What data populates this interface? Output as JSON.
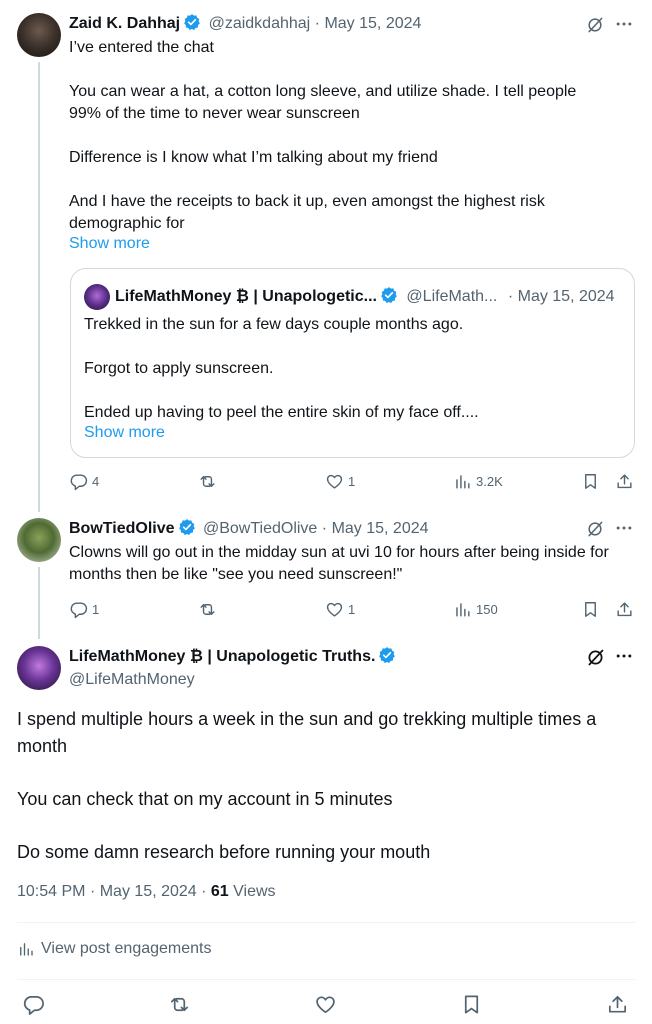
{
  "reply1": {
    "name": "Zaid K. Dahhaj",
    "handle": "@zaidkdahhaj",
    "sep": "·",
    "date": "May 15, 2024",
    "body": "I’ve entered the chat\n\nYou can wear a hat, a cotton long sleeve, and utilize shade. I tell people 99% of the time to never wear sunscreen\n\nDifference is I know what I’m talking about my friend\n\nAnd I have the receipts to back it up, even amongst the highest risk demographic for",
    "show_more": "Show more",
    "quote": {
      "name": "LifeMathMoney ₿ | Unapologetic...",
      "handle": "@LifeMath...",
      "sep": "·",
      "date": "May 15, 2024",
      "body": "Trekked in the sun for a few days couple months ago.\n\nForgot to apply sunscreen.\n\nEnded up having to peel the entire skin of my face off....",
      "show_more": "Show more"
    },
    "stats": {
      "replies": "4",
      "reposts": "",
      "likes": "1",
      "views": "3.2K"
    }
  },
  "reply2": {
    "name": "BowTiedOlive",
    "handle": "@BowTiedOlive",
    "sep": "·",
    "date": "May 15, 2024",
    "body": "Clowns will go out in the midday sun at uvi 10 for hours after being  inside for months then be like \"see you need sunscreen!\"",
    "stats": {
      "replies": "1",
      "reposts": "",
      "likes": "1",
      "views": "150"
    }
  },
  "main": {
    "name": "LifeMathMoney ₿ | Unapologetic Truths.",
    "handle": "@LifeMathMoney",
    "body": "I spend multiple hours a week in the sun and go trekking multiple times a month\n\nYou can check that on my account in 5 minutes\n\nDo some damn research before running your mouth",
    "time": "10:54 PM",
    "sep": "·",
    "date": "May 15, 2024",
    "views_count": "61",
    "views_label": "Views",
    "engagements": "View post engagements"
  },
  "colors": {
    "accent": "#1d9bf0",
    "text": "#0f1419",
    "muted": "#536471",
    "border": "#cfd9de"
  },
  "icons": [
    "grok-icon",
    "more-icon",
    "reply-icon",
    "repost-icon",
    "like-icon",
    "views-icon",
    "bookmark-icon",
    "share-icon",
    "verified-badge-icon"
  ]
}
